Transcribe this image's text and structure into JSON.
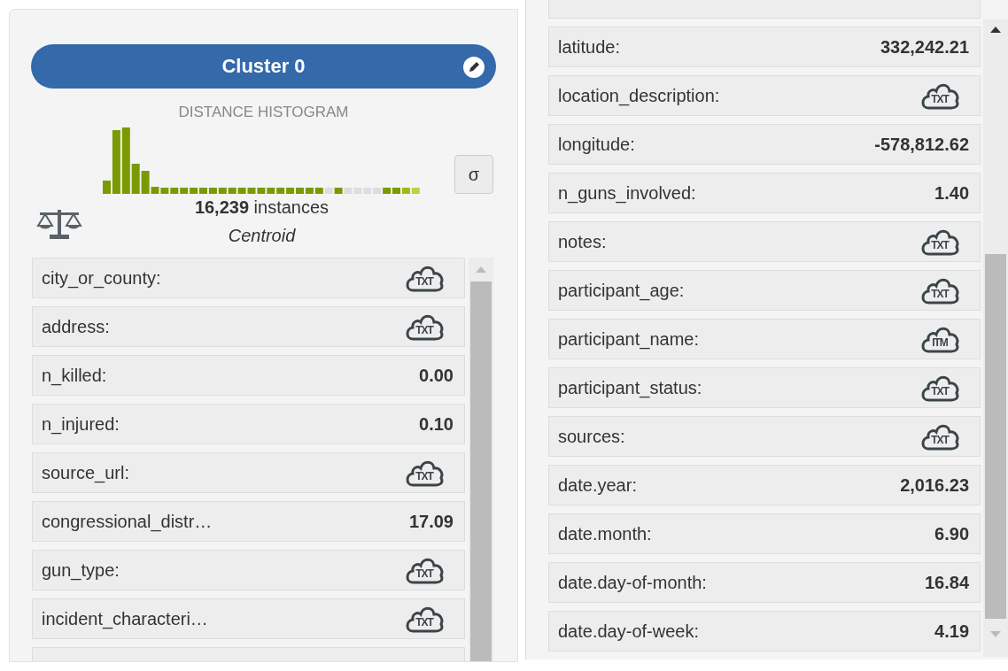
{
  "cluster": {
    "title": "Cluster 0",
    "histogram_title": "DISTANCE HISTOGRAM",
    "instances": "**16,239** instances",
    "centroid_label": "Centroid",
    "sigma_button": "σ"
  },
  "left_fields": [
    {
      "name": "city_or_county:",
      "kind": "text",
      "icon_label": "TXT"
    },
    {
      "name": "address:",
      "kind": "text",
      "icon_label": "TXT"
    },
    {
      "name": "n_killed:",
      "kind": "number",
      "value": "0.00"
    },
    {
      "name": "n_injured:",
      "kind": "number",
      "value": "0.10"
    },
    {
      "name": "source_url:",
      "kind": "text",
      "icon_label": "TXT"
    },
    {
      "name": "congressional_distr…",
      "kind": "number",
      "value": "17.09"
    },
    {
      "name": "gun_type:",
      "kind": "text",
      "icon_label": "TXT"
    },
    {
      "name": "incident_characteri…",
      "kind": "text",
      "icon_label": "TXT"
    }
  ],
  "right_fields": [
    {
      "name": "latitude:",
      "kind": "number",
      "value": "332,242.21"
    },
    {
      "name": "location_description:",
      "kind": "text",
      "icon_label": "TXT"
    },
    {
      "name": "longitude:",
      "kind": "number",
      "value": "-578,812.62"
    },
    {
      "name": "n_guns_involved:",
      "kind": "number",
      "value": "1.40"
    },
    {
      "name": "notes:",
      "kind": "text",
      "icon_label": "TXT"
    },
    {
      "name": "participant_age:",
      "kind": "text",
      "icon_label": "TXT"
    },
    {
      "name": "participant_name:",
      "kind": "items",
      "icon_label": "ITM"
    },
    {
      "name": "participant_status:",
      "kind": "text",
      "icon_label": "TXT"
    },
    {
      "name": "sources:",
      "kind": "text",
      "icon_label": "TXT"
    },
    {
      "name": "date.year:",
      "kind": "number",
      "value": "2,016.23"
    },
    {
      "name": "date.month:",
      "kind": "number",
      "value": "6.90"
    },
    {
      "name": "date.day-of-month:",
      "kind": "number",
      "value": "16.84"
    },
    {
      "name": "date.day-of-week:",
      "kind": "number",
      "value": "4.19"
    }
  ]
}
